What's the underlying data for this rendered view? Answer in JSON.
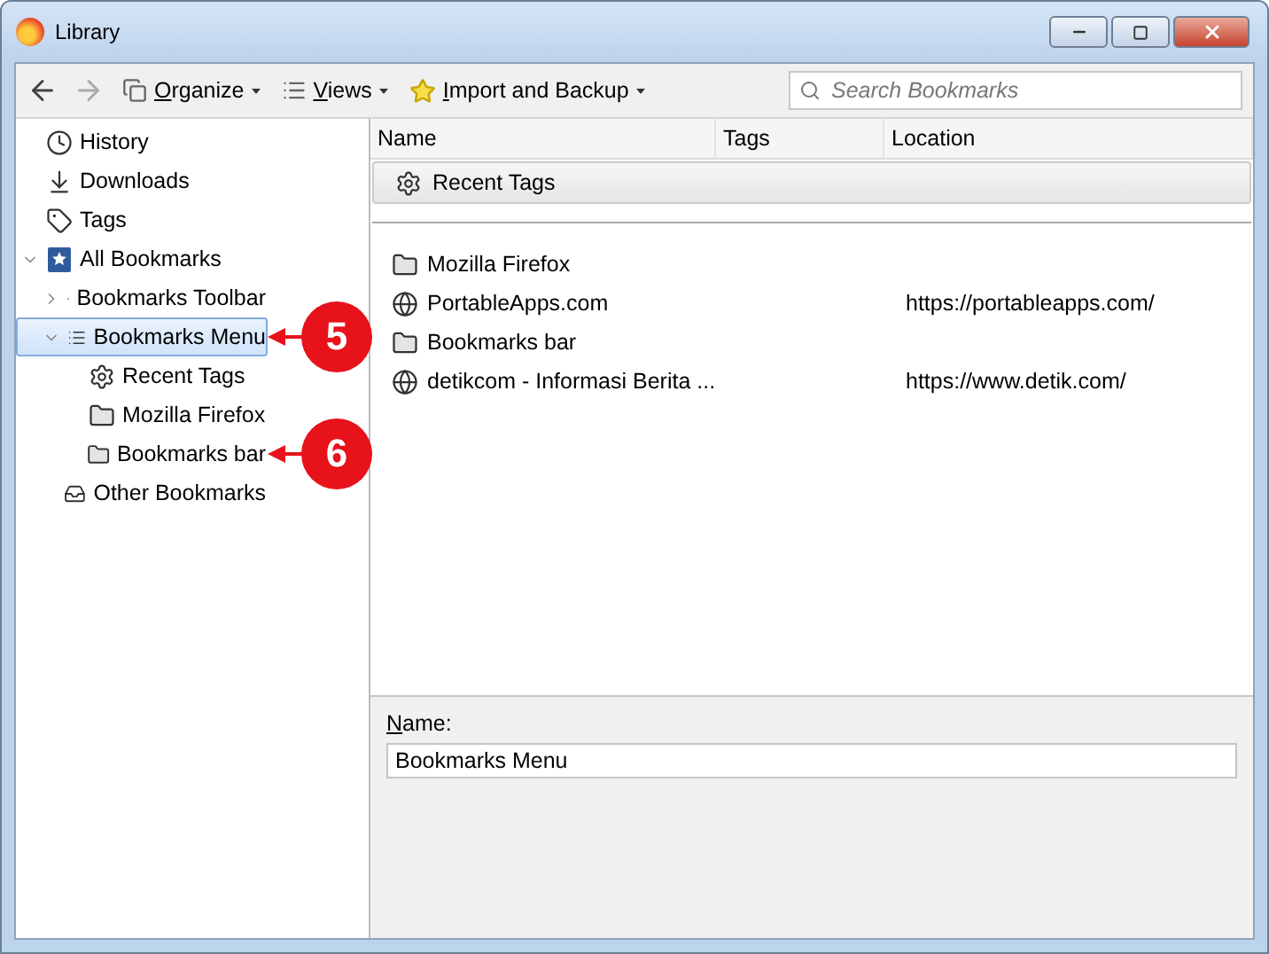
{
  "window": {
    "title": "Library"
  },
  "toolbar": {
    "menus": [
      {
        "label": "Organize",
        "kind": "organize"
      },
      {
        "label": "Views",
        "kind": "views"
      },
      {
        "label": "Import and Backup",
        "kind": "import"
      }
    ],
    "search": {
      "placeholder": "Search Bookmarks"
    }
  },
  "sidebar": {
    "items": [
      {
        "label": "History",
        "kind": "history"
      },
      {
        "label": "Downloads",
        "kind": "downloads"
      },
      {
        "label": "Tags",
        "kind": "tags"
      },
      {
        "label": "All Bookmarks",
        "kind": "all",
        "expanded": true,
        "selected": false,
        "children": [
          {
            "label": "Bookmarks Toolbar",
            "kind": "toolbar",
            "expanded": false,
            "selected": false
          },
          {
            "label": "Bookmarks Menu",
            "kind": "menu",
            "expanded": true,
            "selected": true,
            "callout": "5",
            "children": [
              {
                "label": "Recent Tags",
                "kind": "gear",
                "selected": false
              },
              {
                "label": "Mozilla Firefox",
                "kind": "folder",
                "selected": false
              },
              {
                "label": "Bookmarks bar",
                "kind": "folder",
                "selected": false,
                "callout": "6"
              }
            ]
          },
          {
            "label": "Other Bookmarks",
            "kind": "tray",
            "selected": false
          }
        ]
      }
    ]
  },
  "table": {
    "columns": [
      "Name",
      "Tags",
      "Location"
    ],
    "rows": [
      {
        "name": "Recent Tags",
        "kind": "gear"
      },
      {
        "kind": "separator"
      },
      {
        "name": "Mozilla Firefox",
        "kind": "folder"
      },
      {
        "name": "PortableApps.com",
        "kind": "page",
        "location": "https://portableapps.com/"
      },
      {
        "name": "Bookmarks bar",
        "kind": "folder"
      },
      {
        "name": "detikcom - Informasi Berita ...",
        "kind": "page",
        "location": "https://www.detik.com/"
      }
    ]
  },
  "details": {
    "label": "Name:",
    "value": "Bookmarks Menu"
  }
}
